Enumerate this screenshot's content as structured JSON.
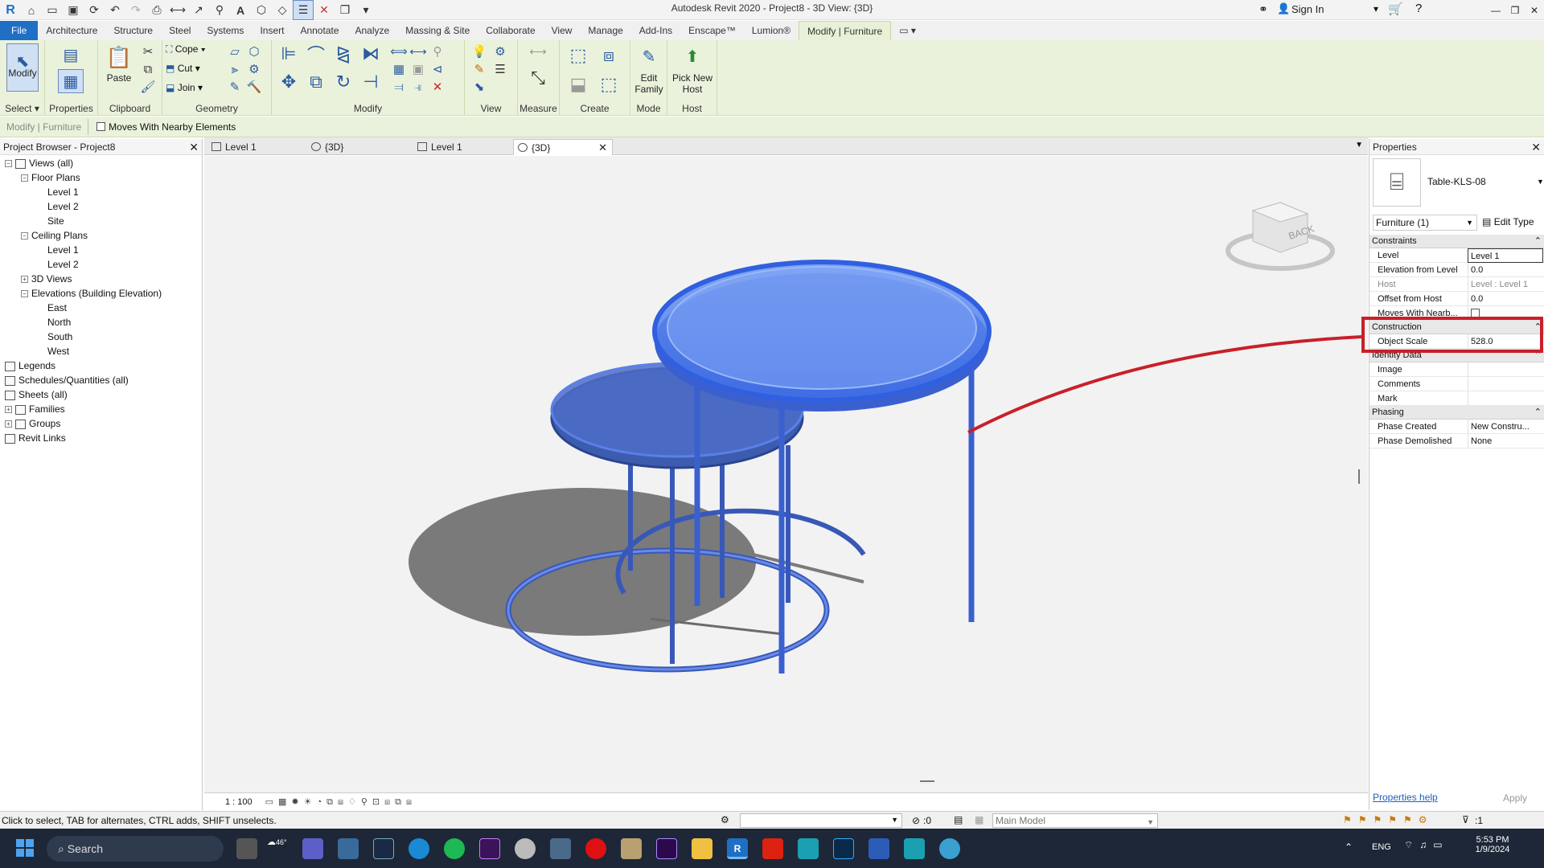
{
  "window": {
    "title": "Autodesk Revit 2020 - Project8 - 3D View: {3D}",
    "sign_in": "Sign In"
  },
  "ribbon_tabs": [
    "File",
    "Architecture",
    "Structure",
    "Steel",
    "Systems",
    "Insert",
    "Annotate",
    "Analyze",
    "Massing & Site",
    "Collaborate",
    "View",
    "Manage",
    "Add-Ins",
    "Enscape™",
    "Lumion®",
    "Modify | Furniture"
  ],
  "ribbon": {
    "modify_label": "Modify",
    "select_label": "Select",
    "properties_label": "Properties",
    "paste_label": "Paste",
    "clipboard_label": "Clipboard",
    "cope_label": "Cope",
    "cut_label": "Cut",
    "join_label": "Join",
    "geometry_label": "Geometry",
    "modify_panel_label": "Modify",
    "view_label": "View",
    "measure_label": "Measure",
    "create_label": "Create",
    "edit_family_label": "Edit Family",
    "mode_label": "Mode",
    "pick_new_host_label": "Pick New Host",
    "host_label": "Host"
  },
  "options_bar": {
    "context": "Modify | Furniture",
    "moves_with_nearby": "Moves With Nearby Elements"
  },
  "project_browser": {
    "title": "Project Browser - Project8",
    "items": [
      {
        "label": "Views (all)",
        "level": 0,
        "exp": "−"
      },
      {
        "label": "Floor Plans",
        "level": 1,
        "exp": "−"
      },
      {
        "label": "Level 1",
        "level": 2
      },
      {
        "label": "Level 2",
        "level": 2
      },
      {
        "label": "Site",
        "level": 2
      },
      {
        "label": "Ceiling Plans",
        "level": 1,
        "exp": "−"
      },
      {
        "label": "Level 1",
        "level": 2
      },
      {
        "label": "Level 2",
        "level": 2
      },
      {
        "label": "3D Views",
        "level": 1,
        "exp": "+"
      },
      {
        "label": "Elevations (Building Elevation)",
        "level": 1,
        "exp": "−"
      },
      {
        "label": "East",
        "level": 2
      },
      {
        "label": "North",
        "level": 2
      },
      {
        "label": "South",
        "level": 2
      },
      {
        "label": "West",
        "level": 2
      },
      {
        "label": "Legends",
        "level": 0
      },
      {
        "label": "Schedules/Quantities (all)",
        "level": 0
      },
      {
        "label": "Sheets (all)",
        "level": 0
      },
      {
        "label": "Families",
        "level": 0,
        "exp": "+"
      },
      {
        "label": "Groups",
        "level": 0,
        "exp": "+"
      },
      {
        "label": "Revit Links",
        "level": 0
      }
    ]
  },
  "view_tabs": [
    "Level 1",
    "{3D}",
    "Level 1",
    "{3D}"
  ],
  "viewcube": {
    "face": "BACK"
  },
  "view_control": {
    "scale": "1 : 100"
  },
  "properties": {
    "title": "Properties",
    "type_name": "Table-KLS-08",
    "selector": "Furniture (1)",
    "edit_type": "Edit Type",
    "groups": {
      "constraints": "Constraints",
      "construction": "Construction",
      "identity": "Identity Data",
      "phasing": "Phasing"
    },
    "rows": {
      "level": {
        "name": "Level",
        "value": "Level 1"
      },
      "elev_from_level": {
        "name": "Elevation from Level",
        "value": "0.0"
      },
      "host": {
        "name": "Host",
        "value": "Level : Level 1"
      },
      "offset_from_host": {
        "name": "Offset from Host",
        "value": "0.0"
      },
      "moves_with": {
        "name": "Moves With Nearb..."
      },
      "object_scale": {
        "name": "Object Scale",
        "value": "528.0"
      },
      "image": {
        "name": "Image",
        "value": ""
      },
      "comments": {
        "name": "Comments",
        "value": ""
      },
      "mark": {
        "name": "Mark",
        "value": ""
      },
      "phase_created": {
        "name": "Phase Created",
        "value": "New Constru..."
      },
      "phase_demolished": {
        "name": "Phase Demolished",
        "value": "None"
      }
    },
    "help": "Properties help",
    "apply": "Apply"
  },
  "status": {
    "hint": "Click to select, TAB for alternates, CTRL adds, SHIFT unselects.",
    "zero": ":0",
    "model": "Main Model",
    "filter_count": ":1"
  },
  "taskbar": {
    "search": "Search",
    "weather": "46°",
    "lang": "ENG",
    "time": "5:53 PM",
    "date": "1/9/2024"
  },
  "colors": {
    "file_tab": "#1f6fc5",
    "ribbon_bg": "#eaf2dc",
    "highlight_red": "#c8202a",
    "taskbar": "#1d2737",
    "selection_blue": "#3a6ee8"
  }
}
